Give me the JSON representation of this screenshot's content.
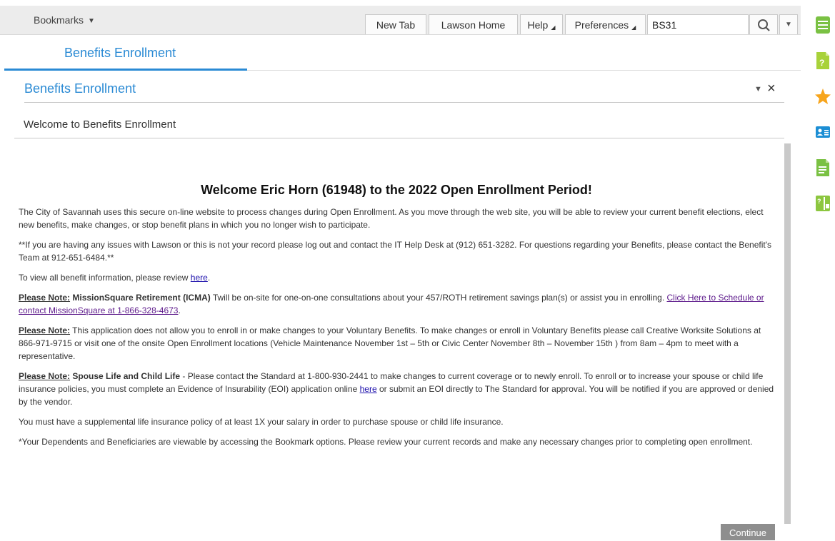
{
  "toolbar": {
    "bookmarks_label": "Bookmarks",
    "new_tab_label": "New Tab",
    "lawson_home_label": "Lawson Home",
    "help_label": "Help",
    "preferences_label": "Preferences",
    "search_value": "BS31"
  },
  "tab": {
    "label": "Benefits Enrollment"
  },
  "panel": {
    "title": "Benefits Enrollment",
    "subtitle": "Welcome to Benefits Enrollment"
  },
  "content": {
    "heading": "Welcome Eric Horn (61948) to the 2022 Open Enrollment Period!",
    "p1": "The City of Savannah uses this secure on-line website to process changes during Open Enrollment. As you move through the web site, you will be able to review your current benefit elections, elect new benefits, make changes, or stop benefit plans in which you no longer wish to participate.",
    "p2": "**If you are having any issues with Lawson or this is not your record please log out and contact the IT Help Desk at (912) 651-3282. For questions regarding your Benefits, please contact the Benefit's Team at 912-651-6484.**",
    "p3_text": "To view all benefit information, please review ",
    "p3_link": "here",
    "p3_end": ".",
    "p4_note": "Please Note:",
    "p4_bold": "MissionSquare Retirement (ICMA)",
    "p4_text": " Twill be on-site for one-on-one consultations about your 457/ROTH retirement savings plan(s) or assist you in enrolling. ",
    "p4_link": "Click Here to Schedule or contact MissionSquare at 1-866-328-4673",
    "p4_end": ".",
    "p5_note": "Please Note:",
    "p5_text": " This application does not allow you to enroll in or make changes to your Voluntary Benefits. To make changes or enroll in Voluntary Benefits please call Creative Worksite Solutions at 866-971-9715 or visit one of the onsite Open Enrollment locations (Vehicle Maintenance November 1st – 5th or Civic Center November 8th – November 15th ) from 8am – 4pm to meet with a representative.",
    "p6_note": "Please Note:",
    "p6_bold": "Spouse Life and Child Life",
    "p6_text": " - Please contact the Standard at 1-800-930-2441 to make changes to current coverage or to newly enroll. To enroll or to increase your spouse or child life insurance policies, you must complete an Evidence of Insurability (EOI) application online ",
    "p6_link": "here",
    "p6_end": " or submit an EOI directly to The Standard for approval. You will be notified if you are approved or denied by the vendor.",
    "p7": "You must have a supplemental life insurance policy of at least 1X your salary in order to purchase spouse or child life insurance.",
    "p8": "*Your Dependents and Beneficiaries are viewable by accessing the Bookmark options. Please review your current records and make any necessary changes prior to completing open enrollment.",
    "continue_label": "Continue"
  },
  "colors": {
    "accent_blue": "#2a8ad4",
    "rail_green": "#7ac143",
    "star_orange": "#f7a51c"
  },
  "rail_icons": [
    "list-icon",
    "help-document-icon",
    "favorites-star-icon",
    "contacts-icon",
    "document-icon",
    "help-export-icon"
  ]
}
